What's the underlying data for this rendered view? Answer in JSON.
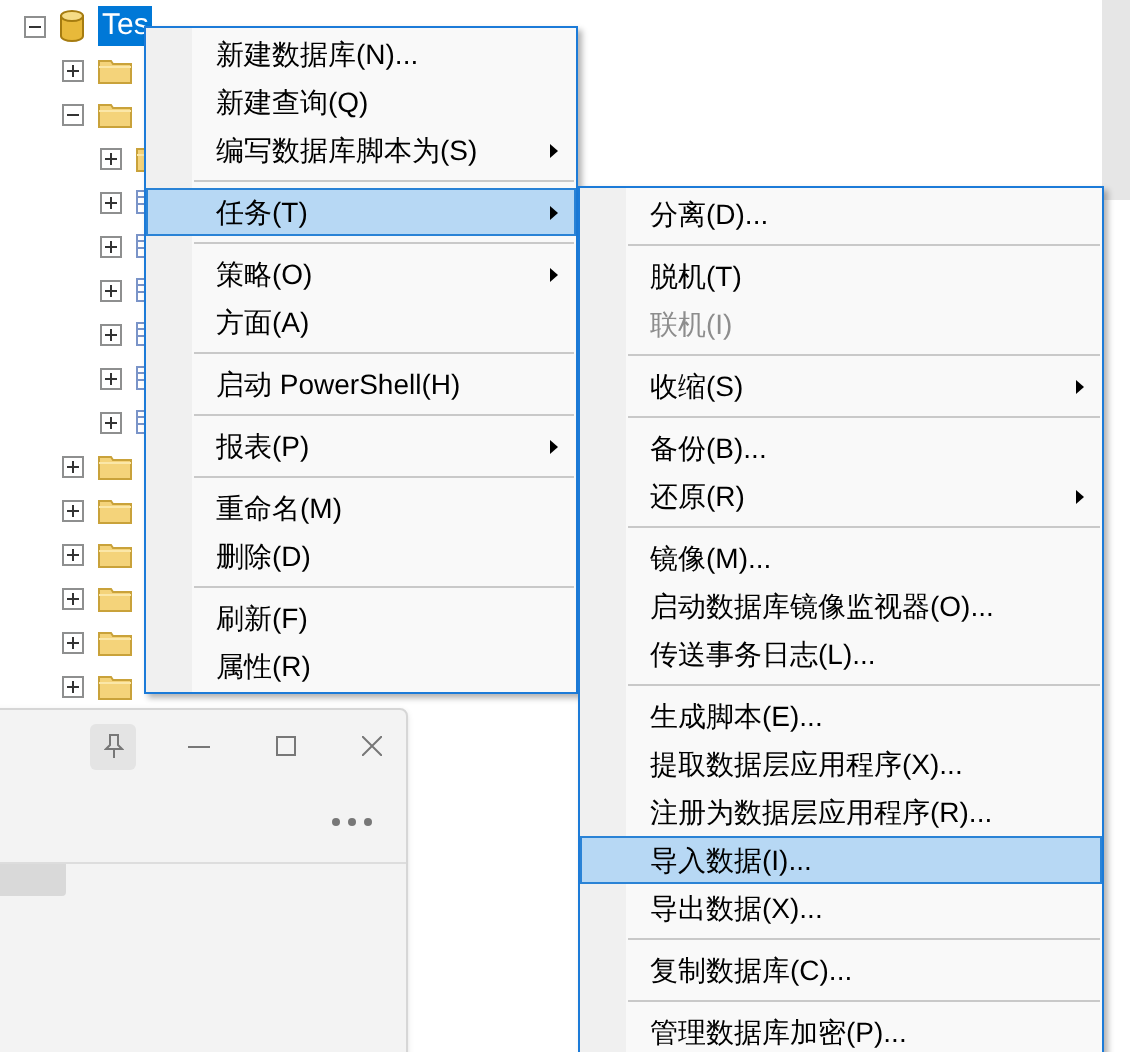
{
  "tree": {
    "root": {
      "label": "Tes",
      "selected": true,
      "expanded": true
    },
    "children": [
      {
        "kind": "folder",
        "expanded": false
      },
      {
        "kind": "folder",
        "expanded": true,
        "children": [
          {
            "kind": "folder",
            "expanded": false
          },
          {
            "kind": "table",
            "expanded": false
          },
          {
            "kind": "table",
            "expanded": false
          },
          {
            "kind": "table",
            "expanded": false
          },
          {
            "kind": "table",
            "expanded": false
          },
          {
            "kind": "table",
            "expanded": false
          },
          {
            "kind": "table",
            "expanded": false
          }
        ]
      },
      {
        "kind": "folder",
        "expanded": false
      },
      {
        "kind": "folder",
        "expanded": false
      },
      {
        "kind": "folder",
        "expanded": false
      },
      {
        "kind": "folder",
        "expanded": false
      },
      {
        "kind": "folder",
        "expanded": false
      },
      {
        "kind": "folder",
        "expanded": false
      }
    ]
  },
  "context_menu": [
    {
      "kind": "item",
      "label": "新建数据库(N)...",
      "submenu": false,
      "selected": false,
      "disabled": false
    },
    {
      "kind": "item",
      "label": "新建查询(Q)",
      "submenu": false,
      "selected": false,
      "disabled": false
    },
    {
      "kind": "item",
      "label": "编写数据库脚本为(S)",
      "submenu": true,
      "selected": false,
      "disabled": false
    },
    {
      "kind": "separator"
    },
    {
      "kind": "item",
      "label": "任务(T)",
      "submenu": true,
      "selected": true,
      "disabled": false
    },
    {
      "kind": "separator"
    },
    {
      "kind": "item",
      "label": "策略(O)",
      "submenu": true,
      "selected": false,
      "disabled": false
    },
    {
      "kind": "item",
      "label": "方面(A)",
      "submenu": false,
      "selected": false,
      "disabled": false
    },
    {
      "kind": "separator"
    },
    {
      "kind": "item",
      "label": "启动 PowerShell(H)",
      "submenu": false,
      "selected": false,
      "disabled": false
    },
    {
      "kind": "separator"
    },
    {
      "kind": "item",
      "label": "报表(P)",
      "submenu": true,
      "selected": false,
      "disabled": false
    },
    {
      "kind": "separator"
    },
    {
      "kind": "item",
      "label": "重命名(M)",
      "submenu": false,
      "selected": false,
      "disabled": false
    },
    {
      "kind": "item",
      "label": "删除(D)",
      "submenu": false,
      "selected": false,
      "disabled": false
    },
    {
      "kind": "separator"
    },
    {
      "kind": "item",
      "label": "刷新(F)",
      "submenu": false,
      "selected": false,
      "disabled": false
    },
    {
      "kind": "item",
      "label": "属性(R)",
      "submenu": false,
      "selected": false,
      "disabled": false
    }
  ],
  "tasks_submenu": [
    {
      "kind": "item",
      "label": "分离(D)...",
      "submenu": false,
      "selected": false,
      "disabled": false
    },
    {
      "kind": "separator"
    },
    {
      "kind": "item",
      "label": "脱机(T)",
      "submenu": false,
      "selected": false,
      "disabled": false
    },
    {
      "kind": "item",
      "label": "联机(I)",
      "submenu": false,
      "selected": false,
      "disabled": true
    },
    {
      "kind": "separator"
    },
    {
      "kind": "item",
      "label": "收缩(S)",
      "submenu": true,
      "selected": false,
      "disabled": false
    },
    {
      "kind": "separator"
    },
    {
      "kind": "item",
      "label": "备份(B)...",
      "submenu": false,
      "selected": false,
      "disabled": false
    },
    {
      "kind": "item",
      "label": "还原(R)",
      "submenu": true,
      "selected": false,
      "disabled": false
    },
    {
      "kind": "separator"
    },
    {
      "kind": "item",
      "label": "镜像(M)...",
      "submenu": false,
      "selected": false,
      "disabled": false
    },
    {
      "kind": "item",
      "label": "启动数据库镜像监视器(O)...",
      "submenu": false,
      "selected": false,
      "disabled": false
    },
    {
      "kind": "item",
      "label": "传送事务日志(L)...",
      "submenu": false,
      "selected": false,
      "disabled": false
    },
    {
      "kind": "separator"
    },
    {
      "kind": "item",
      "label": "生成脚本(E)...",
      "submenu": false,
      "selected": false,
      "disabled": false
    },
    {
      "kind": "item",
      "label": "提取数据层应用程序(X)...",
      "submenu": false,
      "selected": false,
      "disabled": false
    },
    {
      "kind": "item",
      "label": "注册为数据层应用程序(R)...",
      "submenu": false,
      "selected": false,
      "disabled": false
    },
    {
      "kind": "item",
      "label": "导入数据(I)...",
      "submenu": false,
      "selected": true,
      "disabled": false
    },
    {
      "kind": "item",
      "label": "导出数据(X)...",
      "submenu": false,
      "selected": false,
      "disabled": false
    },
    {
      "kind": "separator"
    },
    {
      "kind": "item",
      "label": "复制数据库(C)...",
      "submenu": false,
      "selected": false,
      "disabled": false
    },
    {
      "kind": "separator"
    },
    {
      "kind": "item",
      "label": "管理数据库加密(P)...",
      "submenu": false,
      "selected": false,
      "disabled": false
    }
  ]
}
